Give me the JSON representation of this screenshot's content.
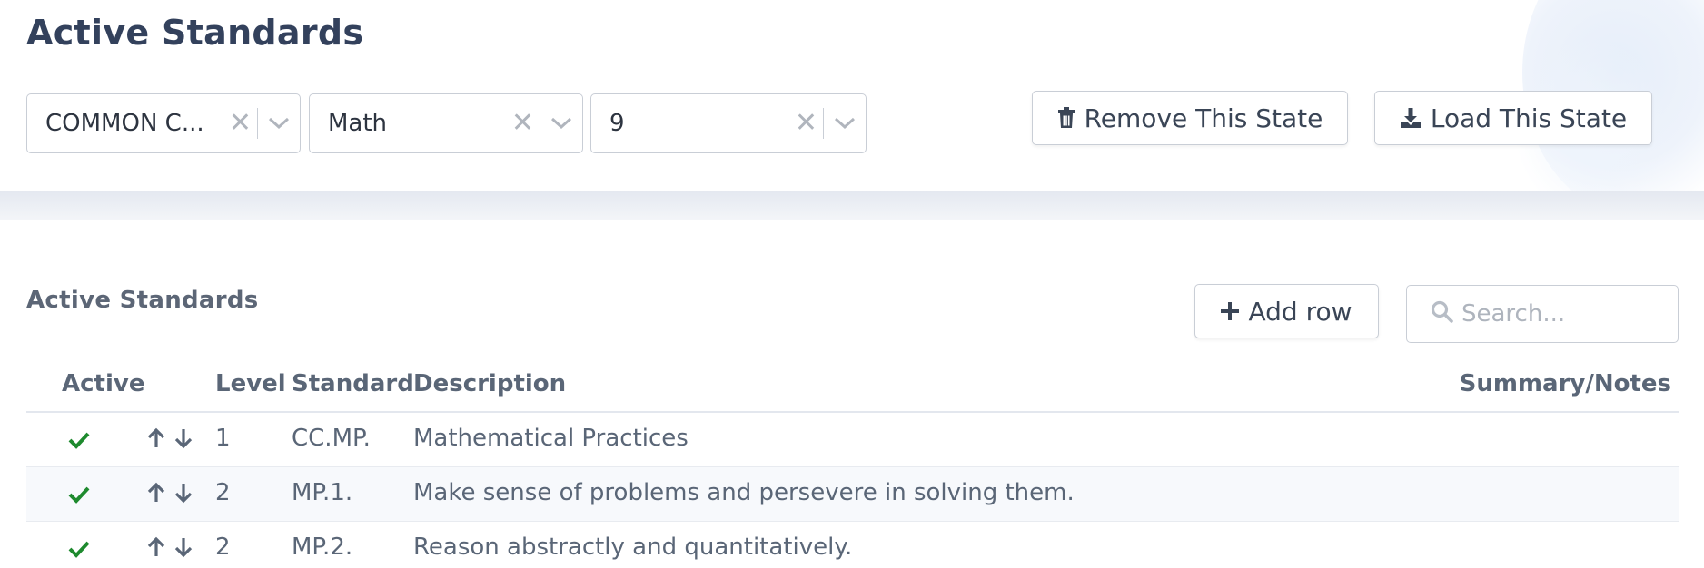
{
  "page": {
    "title": "Active Standards"
  },
  "filters": [
    {
      "value": "COMMON C...",
      "clear_icon": "close-icon",
      "dropdown_icon": "chevron-down-icon"
    },
    {
      "value": "Math",
      "clear_icon": "close-icon",
      "dropdown_icon": "chevron-down-icon"
    },
    {
      "value": "9",
      "clear_icon": "close-icon",
      "dropdown_icon": "chevron-down-icon"
    }
  ],
  "actions": {
    "remove_label": "Remove This State",
    "remove_icon": "trash-icon",
    "load_label": "Load This State",
    "load_icon": "download-icon"
  },
  "section": {
    "title": "Active Standards",
    "add_row_label": "Add row",
    "add_row_icon": "plus-icon",
    "search_placeholder": "Search...",
    "search_icon": "search-icon"
  },
  "table": {
    "headers": {
      "active": "Active",
      "level": "Level",
      "standard": "Standard",
      "description": "Description",
      "summary": "Summary/Notes"
    },
    "rows": [
      {
        "active": true,
        "level": "1",
        "standard": "CC.MP.",
        "description": "Mathematical Practices",
        "summary": ""
      },
      {
        "active": true,
        "level": "2",
        "standard": "MP.1.",
        "description": "Make sense of problems and persevere in solving them.",
        "summary": ""
      },
      {
        "active": true,
        "level": "2",
        "standard": "MP.2.",
        "description": "Reason abstractly and quantitatively.",
        "summary": ""
      }
    ]
  },
  "colors": {
    "check": "#1e8a2e",
    "text": "#5a6677",
    "title": "#33415c",
    "border": "#c9ced6"
  }
}
